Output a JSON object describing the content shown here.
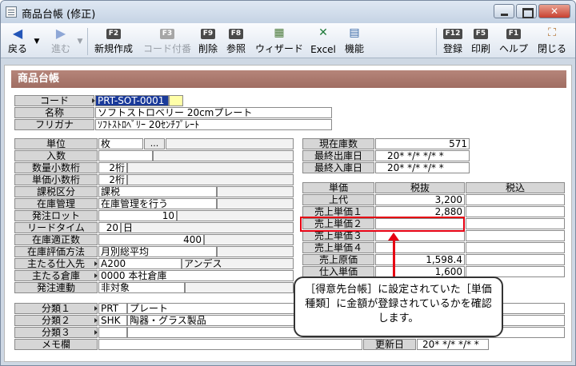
{
  "window": {
    "title": "商品台帳 (修正)"
  },
  "toolbar": {
    "back": "戻る",
    "forward": "進む",
    "new": {
      "key": "F2",
      "label": "新規作成"
    },
    "code_number": {
      "key": "F3",
      "label": "コード付番"
    },
    "delete": {
      "key": "F9",
      "label": "削除"
    },
    "reference": {
      "key": "F8",
      "label": "参照"
    },
    "wizard": "ウィザード",
    "excel": "Excel",
    "function": "機能",
    "register": {
      "key": "F12",
      "label": "登録"
    },
    "print": {
      "key": "F5",
      "label": "印刷"
    },
    "help": {
      "key": "F1",
      "label": "ヘルプ"
    },
    "close": "閉じる"
  },
  "panel_title": "商品台帳",
  "basic": {
    "code_label": "コード",
    "code_value": "PRT-SOT-0001",
    "name_label": "名称",
    "name_value": "ソフトストロベリー 20cmプレート",
    "kana_label": "フリガナ",
    "kana_value": "ｿﾌﾄｽﾄﾛﾍﾞﾘｰ 20ｾﾝﾁﾌﾟﾚｰﾄ"
  },
  "left_fields": [
    {
      "label": "単位",
      "value": "枚",
      "dots": "..."
    },
    {
      "label": "入数",
      "value": ""
    },
    {
      "label": "数量小数桁",
      "value": "2桁"
    },
    {
      "label": "単価小数桁",
      "value": "2桁"
    },
    {
      "label": "課税区分",
      "value": "課税"
    },
    {
      "label": "在庫管理",
      "value": "在庫管理を行う"
    },
    {
      "label": "発注ロット",
      "value": "10"
    },
    {
      "label": "リードタイム",
      "value": "20",
      "unit": "日"
    },
    {
      "label": "在庫適正数",
      "value": "400"
    },
    {
      "label": "在庫評価方法",
      "value": "月別総平均"
    },
    {
      "label": "主たる仕入先",
      "value": "A200",
      "extra": "アンデス"
    },
    {
      "label": "主たる倉庫",
      "value": "0000 本社倉庫"
    },
    {
      "label": "発注連動",
      "value": "非対象"
    }
  ],
  "stock": [
    {
      "label": "現在庫数",
      "value": "571"
    },
    {
      "label": "最終出庫日",
      "value": "20* */* */* *"
    },
    {
      "label": "最終入庫日",
      "value": "20* */* */* *"
    }
  ],
  "price_table": {
    "headers": [
      "単価",
      "税抜",
      "税込"
    ],
    "rows": [
      {
        "label": "上代",
        "excl": "3,200",
        "incl": ""
      },
      {
        "label": "売上単価１",
        "excl": "2,880",
        "incl": ""
      },
      {
        "label": "売上単価２",
        "excl": "",
        "incl": ""
      },
      {
        "label": "売上単価３",
        "excl": "",
        "incl": ""
      },
      {
        "label": "売上単価４",
        "excl": "",
        "incl": ""
      },
      {
        "label": "売上原価",
        "excl": "1,598.4",
        "incl": ""
      },
      {
        "label": "仕入単価",
        "excl": "1,600",
        "incl": ""
      }
    ]
  },
  "categories": [
    {
      "label": "分類１",
      "code": "PRT",
      "name": "プレート"
    },
    {
      "label": "分類２",
      "code": "SHK",
      "name": "陶器・グラス製品"
    },
    {
      "label": "分類３",
      "code": "",
      "name": ""
    }
  ],
  "memo_label": "メモ欄",
  "updated": {
    "label": "更新日",
    "value": "20* */* */* *"
  },
  "callout": "［得意先台帳］に設定されていた［単価種類］に金額が登録されているかを確認します。",
  "colors": {
    "highlight": "#e60012",
    "header": "#a87468"
  }
}
